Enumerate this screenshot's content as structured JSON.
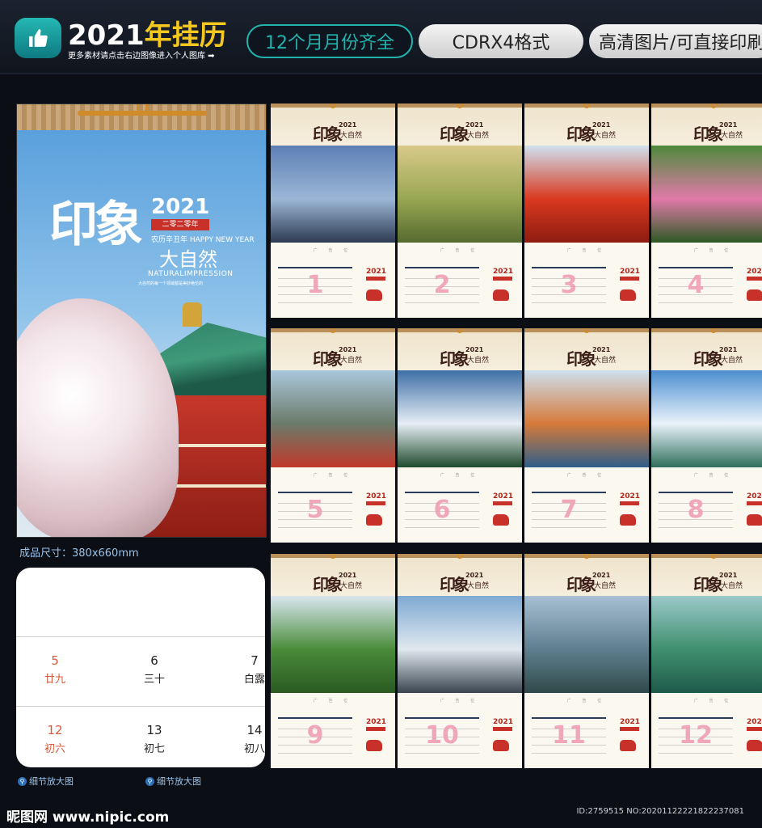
{
  "header": {
    "logo_icon": "thumbs-up-icon",
    "title_year": "2021",
    "title_text": "年挂历",
    "subtitle": "更多素材请点击右边图像进入个人图库 ➡",
    "tags": [
      "12个月月份齐全",
      "CDRX4格式",
      "高清图片/可直接印刷"
    ]
  },
  "cover": {
    "brand": "印象",
    "year": "2021",
    "stamp": "二零二零年",
    "lunar": "农历辛丑年 HAPPY NEW YEAR",
    "nature": "大自然",
    "english": "NATURALIMPRESSION",
    "tagline": "大自然的每一个领域都是美妙绝伦的"
  },
  "size_label": "成品尺寸：380x660mm",
  "zoom": {
    "rows": [
      [
        {
          "day": "5",
          "lunar": "廿九",
          "tone": "red"
        },
        {
          "day": "6",
          "lunar": "三十",
          "tone": "dark"
        },
        {
          "day": "7",
          "lunar": "白露",
          "tone": "dark"
        }
      ],
      [
        {
          "day": "12",
          "lunar": "初六",
          "tone": "red"
        },
        {
          "day": "13",
          "lunar": "初七",
          "tone": "dark"
        },
        {
          "day": "14",
          "lunar": "初八",
          "tone": "dark"
        }
      ]
    ]
  },
  "detail_links": [
    "细节放大图",
    "细节放大图"
  ],
  "month_page": {
    "brand": "印象",
    "year": "2021",
    "nature": "大自然",
    "ad": "广 告 位",
    "side_year": "2021"
  },
  "months": [
    {
      "number": "1",
      "scene": "mountain-peaks",
      "colors": [
        "#5c7fb5",
        "#9bb6d6",
        "#2d3b52"
      ]
    },
    {
      "number": "2",
      "scene": "green-hills",
      "colors": [
        "#d8c98a",
        "#98a752",
        "#556b2f"
      ]
    },
    {
      "number": "3",
      "scene": "red-maple-pagoda",
      "colors": [
        "#cfe1ef",
        "#d9391f",
        "#8e1c10"
      ]
    },
    {
      "number": "4",
      "scene": "lotus-flowers",
      "colors": [
        "#4e8a3c",
        "#e07aa8",
        "#2e5a24"
      ]
    },
    {
      "number": "5",
      "scene": "river-gorge",
      "colors": [
        "#a9c7dc",
        "#6b7b6a",
        "#c0392b"
      ]
    },
    {
      "number": "6",
      "scene": "snow-mountains-forest",
      "colors": [
        "#3e6fa6",
        "#e6eef5",
        "#1f4a2c"
      ]
    },
    {
      "number": "7",
      "scene": "autumn-lake-pagoda",
      "colors": [
        "#cde0ee",
        "#d67a3a",
        "#2f5f8a"
      ]
    },
    {
      "number": "8",
      "scene": "karst-lake",
      "colors": [
        "#4d8ed0",
        "#e9f2fa",
        "#2f6f5a"
      ]
    },
    {
      "number": "9",
      "scene": "pagoda-green-forest",
      "colors": [
        "#d9e6ef",
        "#4a8c3a",
        "#2a5a22"
      ]
    },
    {
      "number": "10",
      "scene": "misty-peak",
      "colors": [
        "#7fa9d2",
        "#dfe8ef",
        "#3a4550"
      ]
    },
    {
      "number": "11",
      "scene": "hazy-mountains",
      "colors": [
        "#a8c0d4",
        "#5f7f8f",
        "#2f4a4a"
      ]
    },
    {
      "number": "12",
      "scene": "guilin-river",
      "colors": [
        "#9cc9c9",
        "#3f8f6f",
        "#1f5a4a"
      ]
    }
  ],
  "footer": {
    "logo": "昵图网 www.nipic.com",
    "id": "ID:2759515 NO:20201122221822237081"
  }
}
